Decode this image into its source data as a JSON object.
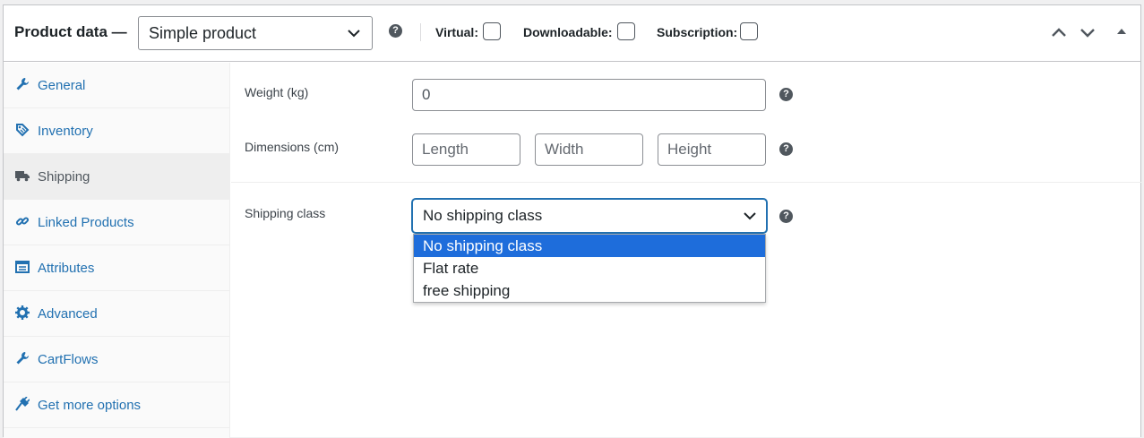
{
  "header": {
    "title": "Product data —",
    "product_type": "Simple product",
    "virtual_label": "Virtual:",
    "downloadable_label": "Downloadable:",
    "subscription_label": "Subscription:"
  },
  "sidebar": {
    "items": [
      {
        "label": "General",
        "icon": "wrench-icon"
      },
      {
        "label": "Inventory",
        "icon": "tag-icon"
      },
      {
        "label": "Shipping",
        "icon": "truck-icon",
        "active": true
      },
      {
        "label": "Linked Products",
        "icon": "link-icon"
      },
      {
        "label": "Attributes",
        "icon": "list-icon"
      },
      {
        "label": "Advanced",
        "icon": "gear-icon"
      },
      {
        "label": "CartFlows",
        "icon": "wrench-icon"
      },
      {
        "label": "Get more options",
        "icon": "plug-icon"
      }
    ]
  },
  "shipping": {
    "weight_label": "Weight (kg)",
    "weight_value": "0",
    "dimensions_label": "Dimensions (cm)",
    "length_placeholder": "Length",
    "width_placeholder": "Width",
    "height_placeholder": "Height",
    "class_label": "Shipping class",
    "class_selected": "No shipping class",
    "class_options": [
      "No shipping class",
      "Flat rate",
      "free shipping"
    ]
  },
  "colors": {
    "link": "#2271b1",
    "selected_option": "#1e6ddb",
    "help_icon": "#50575e"
  }
}
